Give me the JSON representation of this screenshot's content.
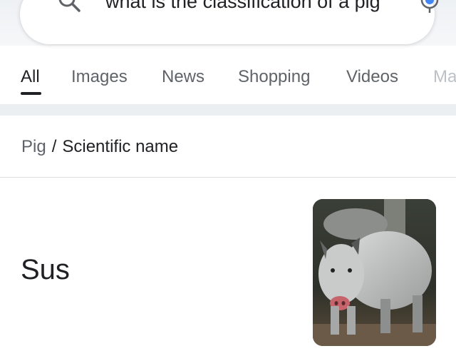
{
  "search": {
    "query": "what is the classification of a pig",
    "icon": "search-icon",
    "mic_icon": "microphone-icon"
  },
  "tabs": [
    {
      "label": "All",
      "active": true
    },
    {
      "label": "Images",
      "active": false
    },
    {
      "label": "News",
      "active": false
    },
    {
      "label": "Shopping",
      "active": false
    },
    {
      "label": "Videos",
      "active": false
    },
    {
      "label": "Ma",
      "active": false
    }
  ],
  "breadcrumb": {
    "link": "Pig",
    "separator": "/",
    "current": "Scientific name"
  },
  "answer": {
    "text": "Sus"
  },
  "thumbnail": {
    "subject": "pig photo"
  },
  "colors": {
    "accent_dark": "#202124",
    "muted": "#5f6368",
    "search_icon": "#5f6368"
  }
}
